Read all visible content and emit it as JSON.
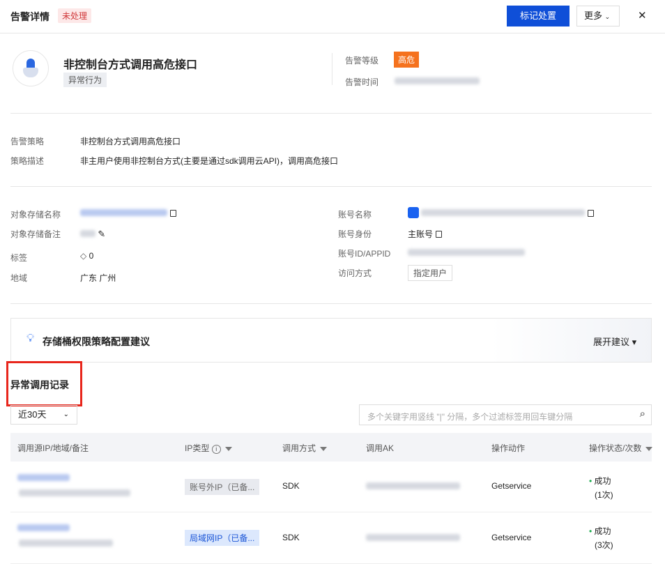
{
  "header": {
    "title": "告警详情",
    "status": "未处理",
    "mark_button": "标记处置",
    "more_button": "更多",
    "close": "✕"
  },
  "alert": {
    "name": "非控制台方式调用高危接口",
    "category": "异常行为",
    "level_label": "告警等级",
    "level": "高危",
    "time_label": "告警时间"
  },
  "policy": {
    "policy_label": "告警策略",
    "policy": "非控制台方式调用高危接口",
    "desc_label": "策略描述",
    "desc": "非主用户使用非控制台方式(主要是通过sdk调用云API)，调用高危接口"
  },
  "object": {
    "bucket_label": "对象存储名称",
    "remark_label": "对象存储备注",
    "tag_label": "标签",
    "tag_count": "0",
    "region_label": "地域",
    "region": "广东 广州"
  },
  "account": {
    "name_label": "账号名称",
    "identity_label": "账号身份",
    "identity": "主账号",
    "id_label": "账号ID/APPID",
    "access_label": "访问方式",
    "access": "指定用户"
  },
  "suggestion": {
    "title": "存储桶权限策略配置建议",
    "expand": "展开建议"
  },
  "records": {
    "title": "异常调用记录",
    "range": "近30天",
    "search_placeholder": "多个关键字用竖线 \"|\" 分隔，多个过滤标签用回车键分隔",
    "columns": [
      "调用源IP/地域/备注",
      "IP类型",
      "调用方式",
      "调用AK",
      "操作动作",
      "操作状态/次数"
    ],
    "rows": [
      {
        "ip_type": "账号外IP（已备...",
        "method": "SDK",
        "action": "Getservice",
        "status": "成功",
        "count": "(1次)"
      },
      {
        "ip_type": "局域网IP（已备...",
        "method": "SDK",
        "action": "Getservice",
        "status": "成功",
        "count": "(3次)"
      }
    ]
  }
}
